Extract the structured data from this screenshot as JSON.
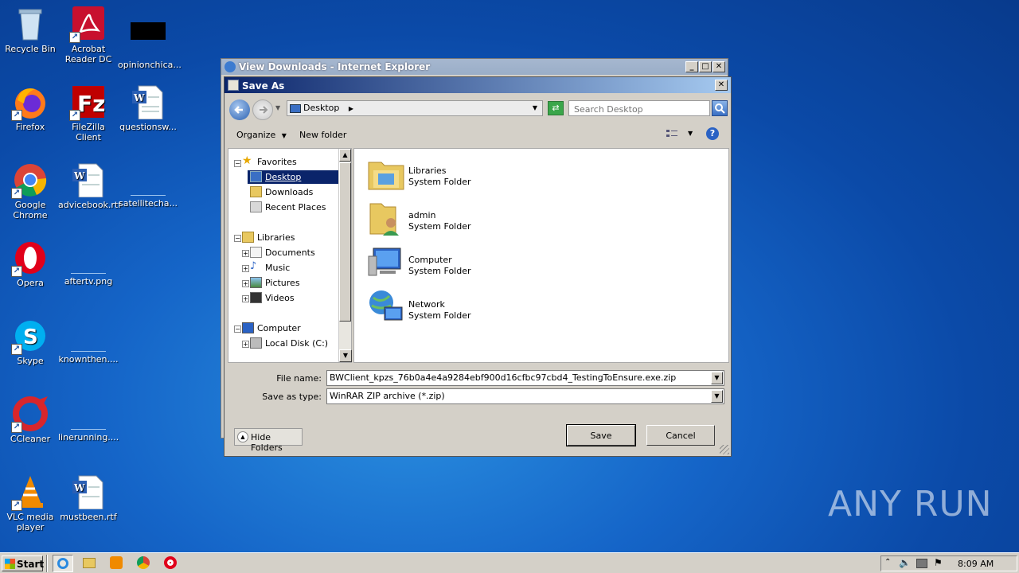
{
  "desktop": {
    "icons": [
      {
        "label": "Recycle Bin"
      },
      {
        "label": "Acrobat Reader DC"
      },
      {
        "label": "opinionchica..."
      },
      {
        "label": "Firefox"
      },
      {
        "label": "FileZilla Client"
      },
      {
        "label": "questionsw..."
      },
      {
        "label": "Google Chrome"
      },
      {
        "label": "advicebook.rtf"
      },
      {
        "label": "satellitecha..."
      },
      {
        "label": "Opera"
      },
      {
        "label": "aftertv.png"
      },
      {
        "label": "Skype"
      },
      {
        "label": "knownthen...."
      },
      {
        "label": "CCleaner"
      },
      {
        "label": "linerunning...."
      },
      {
        "label": "VLC media player"
      },
      {
        "label": "mustbeen.rtf"
      }
    ]
  },
  "ie_window": {
    "title": "View Downloads - Internet Explorer"
  },
  "dialog": {
    "title": "Save As",
    "address": "Desktop",
    "search_placeholder": "Search Desktop",
    "toolbar": {
      "organize": "Organize",
      "new_folder": "New folder"
    },
    "tree": {
      "favorites": "Favorites",
      "desktop": "Desktop",
      "downloads": "Downloads",
      "recent": "Recent Places",
      "libraries": "Libraries",
      "documents": "Documents",
      "music": "Music",
      "pictures": "Pictures",
      "videos": "Videos",
      "computer": "Computer",
      "local_disk": "Local Disk (C:)"
    },
    "items": [
      {
        "name": "Libraries",
        "type": "System Folder"
      },
      {
        "name": "admin",
        "type": "System Folder"
      },
      {
        "name": "Computer",
        "type": "System Folder"
      },
      {
        "name": "Network",
        "type": "System Folder"
      }
    ],
    "file_name_label": "File name:",
    "file_name": "BWClient_kpzs_76b0a4e4a9284ebf900d16cfbc97cbd4_TestingToEnsure.exe.zip",
    "save_type_label": "Save as type:",
    "save_type": "WinRAR ZIP archive (*.zip)",
    "hide_folders": "Hide Folders",
    "save": "Save",
    "cancel": "Cancel"
  },
  "taskbar": {
    "start": "Start",
    "clock": "8:09 AM"
  },
  "watermark": "ANY RUN",
  "colors": {
    "title_active": "#0a246a",
    "desktop": "#1565c8",
    "selection": "#0a246a"
  }
}
